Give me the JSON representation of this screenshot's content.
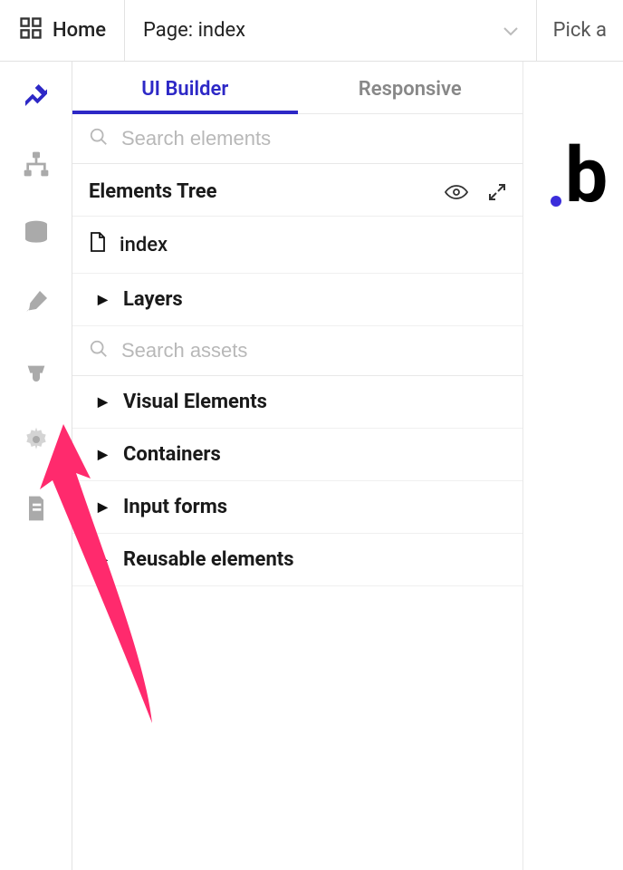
{
  "topbar": {
    "home_label": "Home",
    "page_label": "Page: index",
    "pick_label": "Pick a"
  },
  "rail": {
    "items": [
      {
        "name": "design",
        "active": true
      },
      {
        "name": "workflow",
        "active": false
      },
      {
        "name": "data",
        "active": false
      },
      {
        "name": "styles",
        "active": false
      },
      {
        "name": "plugins",
        "active": false
      },
      {
        "name": "settings",
        "active": false
      },
      {
        "name": "logs",
        "active": false
      }
    ]
  },
  "tabs": {
    "ui_builder": "UI Builder",
    "responsive": "Responsive"
  },
  "search_elements_placeholder": "Search elements",
  "elements_tree_label": "Elements Tree",
  "page_name": "index",
  "tree": {
    "layers": "Layers"
  },
  "search_assets_placeholder": "Search assets",
  "categories": [
    "Visual Elements",
    "Containers",
    "Input forms",
    "Reusable elements"
  ],
  "colors": {
    "accent": "#2d28c6",
    "annotation": "#ff2a6d"
  }
}
